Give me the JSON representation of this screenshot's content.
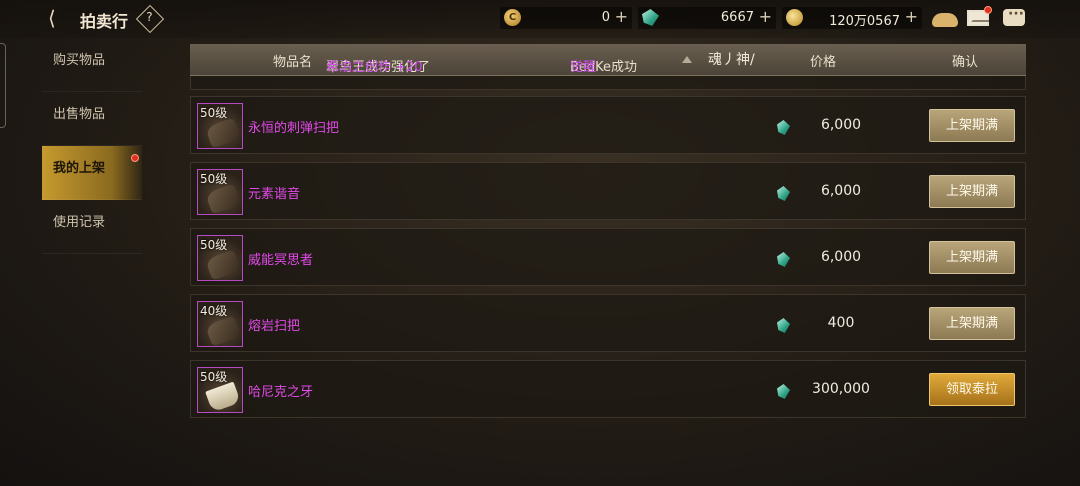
{
  "topbar": {
    "title": "拍卖行",
    "help_label": "?",
    "gold_symbol": "C",
    "gold_value": "0",
    "gem_value": "6667",
    "coin_value": "120万0567",
    "plus": "+"
  },
  "menu": [
    {
      "label": "购买物品"
    },
    {
      "label": "出售物品"
    },
    {
      "label": "我的上架"
    },
    {
      "label": "使用记录"
    }
  ],
  "header": {
    "col_name": "物品名",
    "marquee_a": "翠鸟王成功强化了",
    "marquee_hl": "希泊之创作 +20",
    "marquee_b": "BedKe成功",
    "marquee_hl2": "觉醒",
    "marquee_c": "魂丿神/",
    "col_price": "价格",
    "col_confirm": "确认"
  },
  "listings": [
    {
      "level": "50级",
      "name": "永恒的刺弹扫把",
      "price": "6,000",
      "action": "上架期满"
    },
    {
      "level": "50级",
      "name": "元素谐音",
      "price": "6,000",
      "action": "上架期满"
    },
    {
      "level": "50级",
      "name": "威能冥思者",
      "price": "6,000",
      "action": "上架期满"
    },
    {
      "level": "40级",
      "name": "熔岩扫把",
      "price": "400",
      "action": "上架期满"
    },
    {
      "level": "50级",
      "name": "哈尼克之牙",
      "price": "300,000",
      "action": "领取泰拉"
    }
  ],
  "colors": {
    "item_name": "#e24ae8",
    "accent_gold": "#c69a2e",
    "claim_button": "#e0a93a"
  },
  "icons": [
    "back-arrow-icon",
    "help-icon",
    "gold-coin-icon",
    "gem-icon",
    "coin-icon",
    "bag-icon",
    "mail-icon",
    "chat-icon"
  ]
}
